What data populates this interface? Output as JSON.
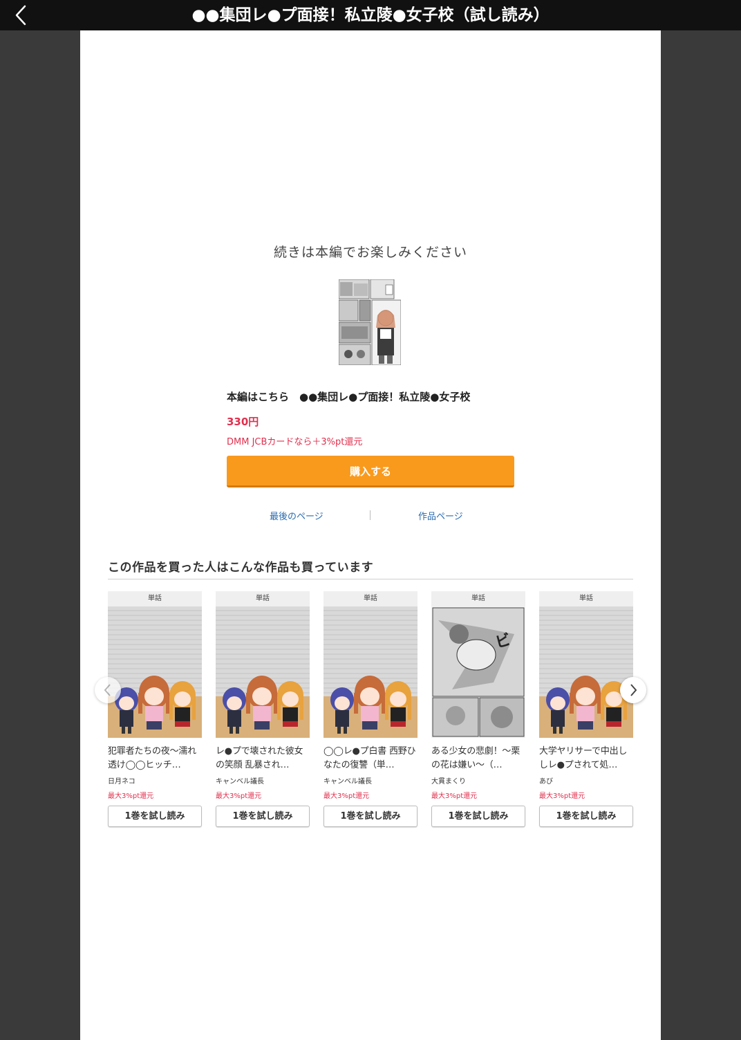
{
  "header": {
    "title": "●●集団レ●プ面接！私立陵●女子校（試し読み）",
    "back_icon": "chevron-left-icon"
  },
  "end_panel": {
    "message": "続きは本編でお楽しみください",
    "main_link": "本編はこちら　●●集団レ●プ面接！私立陵●女子校",
    "price": "330円",
    "cashback": "DMM JCBカードなら＋3%pt還元",
    "buy_label": "購入する",
    "last_page_link": "最後のページ",
    "work_page_link": "作品ページ",
    "accent_color": "#f99a1d",
    "price_color": "#e0304e"
  },
  "recommendations": {
    "title": "この作品を買った人はこんな作品も買っています",
    "items": [
      {
        "badge": "単話",
        "name": "犯罪者たちの夜〜濡れ透け◯◯ヒッチ…",
        "author": "日月ネコ",
        "points": "最大3%pt還元",
        "trial": "1巻を試し読み"
      },
      {
        "badge": "単話",
        "name": "レ●プで壊された彼女の笑顔 乱暴され…",
        "author": "キャンベル議長",
        "points": "最大3%pt還元",
        "trial": "1巻を試し読み"
      },
      {
        "badge": "単話",
        "name": "◯◯レ●プ白書 西野ひなたの復讐（単…",
        "author": "キャンベル議長",
        "points": "最大3%pt還元",
        "trial": "1巻を試し読み"
      },
      {
        "badge": "単話",
        "name": "ある少女の悲劇！〜栗の花は嫌い〜（…",
        "author": "大貫まくり",
        "points": "最大3%pt還元",
        "trial": "1巻を試し読み"
      },
      {
        "badge": "単話",
        "name": "大学ヤリサーで中出ししレ●プされて処…",
        "author": "あび",
        "points": "最大3%pt還元",
        "trial": "1巻を試し読み"
      }
    ],
    "prev_icon": "chevron-left-icon",
    "next_icon": "chevron-right-icon"
  }
}
